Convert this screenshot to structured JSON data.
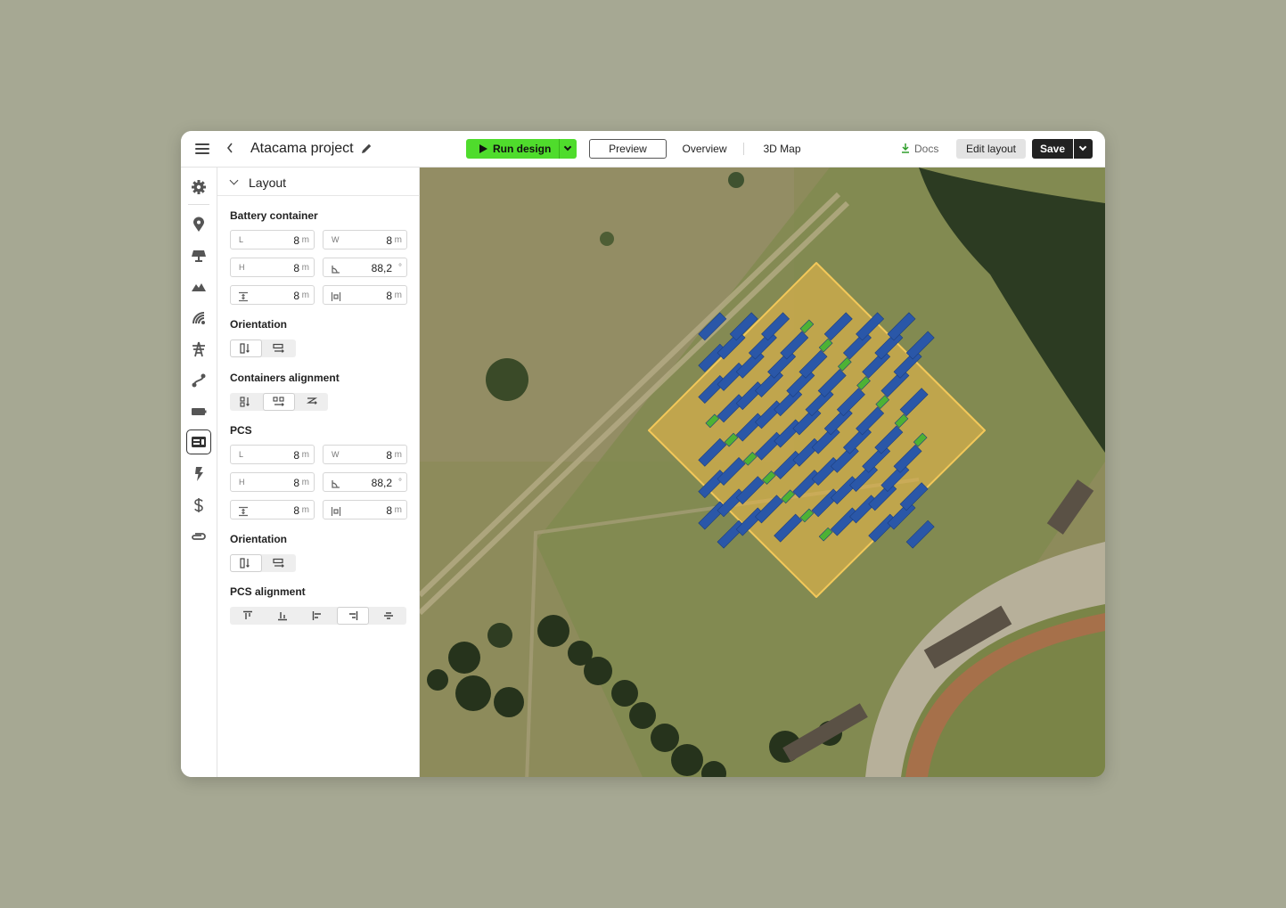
{
  "header": {
    "title": "Atacama project",
    "run_label": "Run design",
    "tabs": [
      {
        "label": "Preview",
        "active": true
      },
      {
        "label": "Overview",
        "active": false
      },
      {
        "label": "3D Map",
        "active": false
      }
    ],
    "docs_label": "Docs",
    "edit_layout_label": "Edit layout",
    "save_label": "Save"
  },
  "rail": {
    "icons": [
      "gear-icon",
      "location-pin-icon",
      "solar-panel-icon",
      "terrain-icon",
      "wind-icon",
      "transmission-tower-icon",
      "route-icon",
      "battery-icon",
      "layout-icon",
      "lightning-icon",
      "dollar-icon",
      "paperclip-icon"
    ],
    "active": "layout-icon"
  },
  "panel": {
    "header": "Layout",
    "battery": {
      "title": "Battery container",
      "fields": [
        {
          "label": "L",
          "value": "8",
          "unit": "m"
        },
        {
          "label": "W",
          "value": "8",
          "unit": "m"
        },
        {
          "label": "H",
          "value": "8",
          "unit": "m"
        },
        {
          "label": "angle",
          "value": "88,2",
          "unit": "°"
        },
        {
          "label": "spacing",
          "value": "8",
          "unit": "m"
        },
        {
          "label": "gap",
          "value": "8",
          "unit": "m"
        }
      ]
    },
    "orientation1": {
      "title": "Orientation"
    },
    "containers_alignment": {
      "title": "Containers alignment"
    },
    "pcs": {
      "title": "PCS",
      "fields": [
        {
          "label": "L",
          "value": "8",
          "unit": "m"
        },
        {
          "label": "W",
          "value": "8",
          "unit": "m"
        },
        {
          "label": "H",
          "value": "8",
          "unit": "m"
        },
        {
          "label": "angle",
          "value": "88,2",
          "unit": "°"
        },
        {
          "label": "spacing",
          "value": "8",
          "unit": "m"
        },
        {
          "label": "gap",
          "value": "8",
          "unit": "m"
        }
      ]
    },
    "orientation2": {
      "title": "Orientation"
    },
    "pcs_alignment": {
      "title": "PCS alignment"
    }
  },
  "colors": {
    "run_green": "#4fdc2c",
    "site_fill": "#e8b74a",
    "battery_blue": "#2a57a8",
    "pcs_green": "#4db234"
  }
}
